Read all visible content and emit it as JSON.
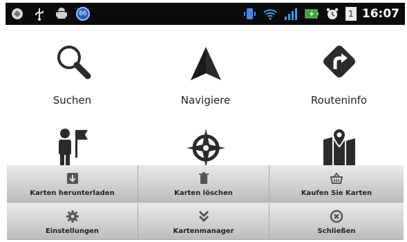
{
  "status_bar": {
    "notification_badge": "86",
    "sim_indicator": "1",
    "time": "16:07"
  },
  "tiles": [
    {
      "label": "Suchen",
      "icon": "search-icon"
    },
    {
      "label": "Navigiere",
      "icon": "navigate-arrow-icon"
    },
    {
      "label": "Routeninfo",
      "icon": "route-info-icon"
    },
    {
      "label": "",
      "icon": "person-flag-icon"
    },
    {
      "label": "",
      "icon": "compass-rose-icon"
    },
    {
      "label": "",
      "icon": "map-pin-icon"
    }
  ],
  "menu": {
    "items": [
      {
        "label": "Karten herunterladen",
        "icon": "download-icon"
      },
      {
        "label": "Karten löschen",
        "icon": "trash-icon"
      },
      {
        "label": "Kaufen Sie Karten",
        "icon": "basket-icon"
      },
      {
        "label": "Einstellungen",
        "icon": "gear-icon"
      },
      {
        "label": "Kartenmanager",
        "icon": "chevrons-down-icon"
      },
      {
        "label": "Schließen",
        "icon": "close-circle-icon"
      }
    ]
  },
  "colors": {
    "status_bar_bg": "#0b0b0b",
    "menu_bg": "#cfcfcf",
    "icon_dark": "#2b2b2b",
    "signal_green": "#3aa33a"
  }
}
